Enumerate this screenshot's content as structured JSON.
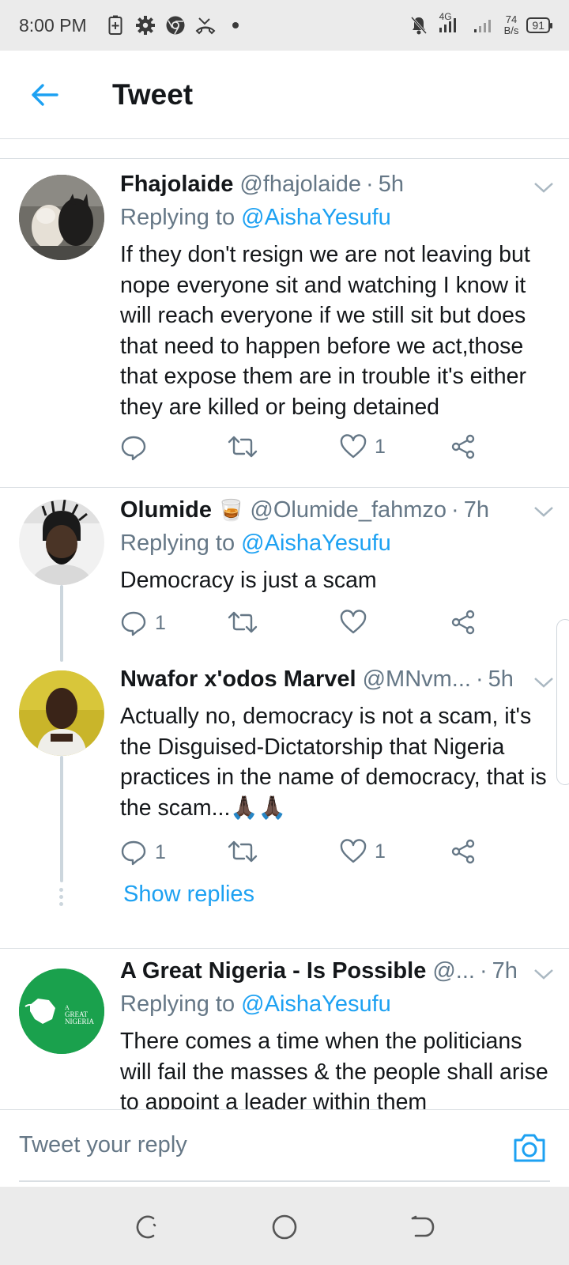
{
  "status_bar": {
    "time": "8:00 PM",
    "network": "4G",
    "speed_value": "74",
    "speed_unit": "B/s",
    "battery": "91"
  },
  "header": {
    "title": "Tweet"
  },
  "tweets": [
    {
      "name": "Fhajolaide",
      "handle": "@fhajolaide",
      "time": "5h",
      "replying_prefix": "Replying to ",
      "replying_to": "@AishaYesufu",
      "text": "If they don't resign we are not leaving but nope everyone sit and watching I know it will reach everyone if we still sit but does that need to happen before we act,those that expose them are in trouble it's either they are killed or being detained",
      "reply_count": "",
      "retweet_count": "",
      "like_count": "1"
    },
    {
      "name": "Olumide",
      "name_emoji": "🥃",
      "handle": "@Olumide_fahmzo",
      "time": "7h",
      "replying_prefix": "Replying to ",
      "replying_to": "@AishaYesufu",
      "text": "Democracy is just a scam",
      "reply_count": "1",
      "retweet_count": "",
      "like_count": ""
    },
    {
      "name": "Nwafor x'odos Marvel",
      "handle": "@MNvm...",
      "time": "5h",
      "text": "Actually no, democracy is not a scam, it's the Disguised-Dictatorship that Nigeria practices in the name of democracy, that is the scam...🙏🏿🙏🏿",
      "reply_count": "1",
      "retweet_count": "",
      "like_count": "1",
      "show_replies": "Show replies"
    },
    {
      "name": "A Great Nigeria - Is Possible",
      "handle": "@...",
      "time": "7h",
      "replying_prefix": "Replying to ",
      "replying_to": "@AishaYesufu",
      "text": "There comes a time when the politicians will fail the masses & the people shall arise to appoint a leader within them",
      "avatar_logo_text": "A GREAT NIGERIA"
    }
  ],
  "reply_bar": {
    "placeholder": "Tweet your reply"
  },
  "colors": {
    "accent": "#1da1f2",
    "secondary_text": "#657786",
    "logo_green": "#1aa14d"
  }
}
